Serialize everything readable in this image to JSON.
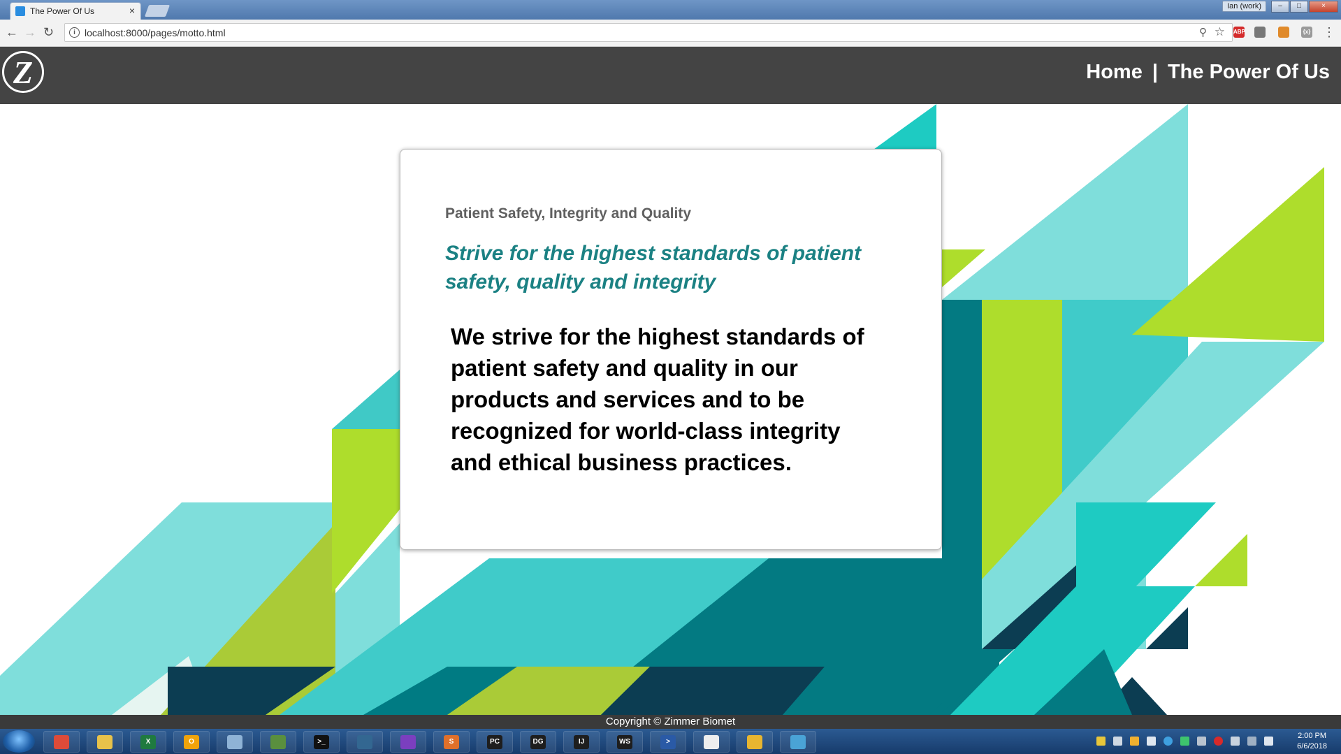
{
  "browser": {
    "tab_title": "The Power Of Us",
    "close_tab": "×",
    "user_badge": "Ian (work)",
    "minimize": "–",
    "maximize": "□",
    "close": "×",
    "back": "←",
    "forward": "→",
    "reload": "↻",
    "url": "localhost:8000/pages/motto.html",
    "info": "i",
    "zoom": "⚲",
    "bookmark": "☆",
    "extensions": [
      {
        "name": "adblock-icon",
        "color": "#d42b2b",
        "label": "ABP"
      },
      {
        "name": "extension-icon",
        "color": "#777777",
        "label": ""
      },
      {
        "name": "calendar-icon",
        "color": "#e08a2b",
        "label": ""
      },
      {
        "name": "json-viewer-icon",
        "color": "#9a9a9a",
        "label": "{x}"
      }
    ],
    "menu": "⋮"
  },
  "site": {
    "logo_letter": "Z",
    "nav": {
      "home": "Home",
      "separator": "|",
      "power": "The Power Of Us"
    },
    "colors": {
      "header": "#444444",
      "heading": "#1b8183",
      "teal": "#1ecbc2",
      "lime": "#aedd2c"
    }
  },
  "card": {
    "kicker": "Patient Safety, Integrity and Quality",
    "heading": "Strive for the highest standards of patient safety, quality and integrity",
    "body": "We strive for the highest standards of patient safety and quality in our products and services and to be recognized for world-class integrity and ethical business practices."
  },
  "footer": {
    "copyright": "Copyright © Zimmer Biomet"
  },
  "taskbar": {
    "apps": [
      {
        "name": "chrome-icon",
        "color": "#dd4b39",
        "label": ""
      },
      {
        "name": "file-explorer-icon",
        "color": "#e8c24a",
        "label": ""
      },
      {
        "name": "excel-icon",
        "color": "#1f7a3f",
        "label": "X"
      },
      {
        "name": "outlook-icon",
        "color": "#f0a30a",
        "label": "O"
      },
      {
        "name": "notes-icon",
        "color": "#8fb3d6",
        "label": ""
      },
      {
        "name": "remote-desktop-icon",
        "color": "#5a8f3e",
        "label": ""
      },
      {
        "name": "terminal-icon",
        "color": "#111111",
        "label": ">_"
      },
      {
        "name": "postgres-icon",
        "color": "#336791",
        "label": ""
      },
      {
        "name": "visual-studio-icon",
        "color": "#7b3fbf",
        "label": ""
      },
      {
        "name": "sublime-icon",
        "color": "#e0702a",
        "label": "S"
      },
      {
        "name": "pycharm-icon",
        "color": "#1e1e1e",
        "label": "PC"
      },
      {
        "name": "datagrip-icon",
        "color": "#1e1e1e",
        "label": "DG"
      },
      {
        "name": "intellij-icon",
        "color": "#1e1e1e",
        "label": "IJ"
      },
      {
        "name": "webstorm-icon",
        "color": "#1e1e1e",
        "label": "WS"
      },
      {
        "name": "powershell-icon",
        "color": "#2a5aa6",
        "label": ">"
      },
      {
        "name": "barcode-icon",
        "color": "#eeeeee",
        "label": ""
      },
      {
        "name": "unlock-icon",
        "color": "#e8b530",
        "label": ""
      },
      {
        "name": "app-icon",
        "color": "#4aa3d6",
        "label": ""
      }
    ],
    "time": "2:00 PM",
    "date": "6/6/2018"
  }
}
